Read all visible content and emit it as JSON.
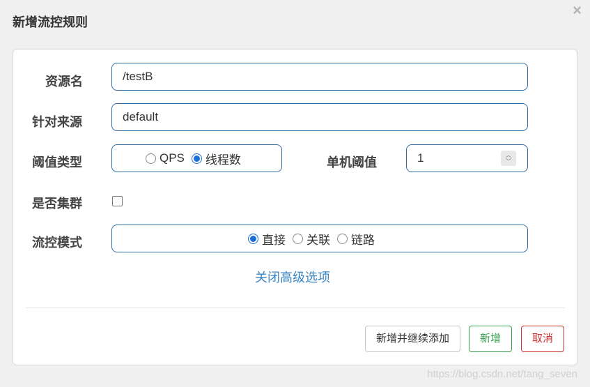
{
  "dialog": {
    "title": "新增流控规则",
    "close_icon": "×"
  },
  "form": {
    "resource": {
      "label": "资源名",
      "value": "/testB"
    },
    "limit_app": {
      "label": "针对来源",
      "value": "default"
    },
    "grade": {
      "label": "阈值类型",
      "options": [
        "QPS",
        "线程数"
      ],
      "selected": "线程数"
    },
    "threshold": {
      "label": "单机阈值",
      "value": "1"
    },
    "cluster": {
      "label": "是否集群",
      "checked": false
    },
    "strategy": {
      "label": "流控模式",
      "options": [
        "直接",
        "关联",
        "链路"
      ],
      "selected": "直接"
    },
    "advanced_link": "关闭高级选项"
  },
  "buttons": {
    "add_continue": "新增并继续添加",
    "add": "新增",
    "cancel": "取消"
  },
  "watermark": "https://blog.csdn.net/tang_seven",
  "colors": {
    "accent": "#2f6ca6",
    "link": "#3a86c4",
    "success": "#35a050",
    "danger": "#c9302c"
  }
}
